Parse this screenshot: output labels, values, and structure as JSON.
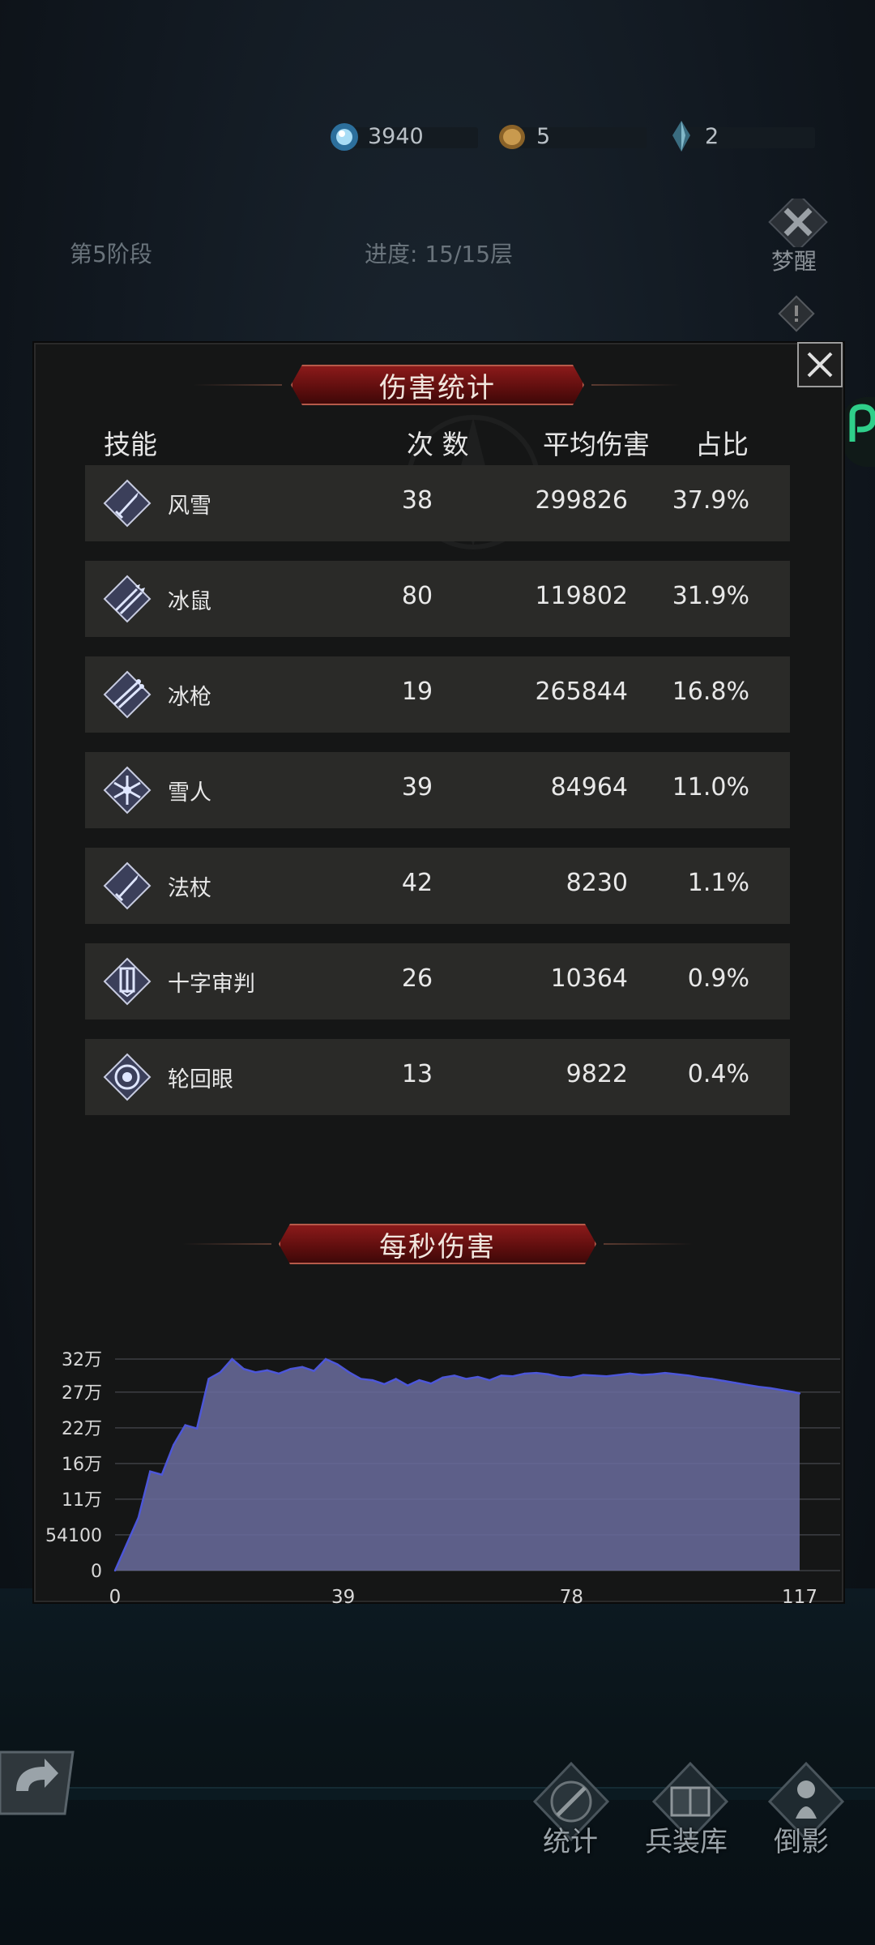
{
  "resources": [
    {
      "icon": "water-orb-icon",
      "value": "3940"
    },
    {
      "icon": "coin-icon",
      "value": "5"
    },
    {
      "icon": "crystal-icon",
      "value": "2"
    }
  ],
  "stage": {
    "label": "第5阶段",
    "progress": "进度: 15/15层"
  },
  "awaken_label": "梦醒",
  "damage_stats": {
    "title": "伤害统计",
    "headers": {
      "skill": "技能",
      "count": "次 数",
      "avg": "平均伤害",
      "ratio": "占比"
    },
    "rows": [
      {
        "icon": "sword-icon",
        "name": "风雪",
        "count": "38",
        "avg": "299826",
        "ratio": "37.9%"
      },
      {
        "icon": "arrows-icon",
        "name": "冰鼠",
        "count": "80",
        "avg": "119802",
        "ratio": "31.9%"
      },
      {
        "icon": "spears-icon",
        "name": "冰枪",
        "count": "19",
        "avg": "265844",
        "ratio": "16.8%"
      },
      {
        "icon": "snowflake-icon",
        "name": "雪人",
        "count": "39",
        "avg": "84964",
        "ratio": "11.0%"
      },
      {
        "icon": "staff-icon",
        "name": "法杖",
        "count": "42",
        "avg": "8230",
        "ratio": "1.1%"
      },
      {
        "icon": "banner-icon",
        "name": "十字审判",
        "count": "26",
        "avg": "10364",
        "ratio": "0.9%"
      },
      {
        "icon": "eye-icon",
        "name": "轮回眼",
        "count": "13",
        "avg": "9822",
        "ratio": "0.4%"
      }
    ]
  },
  "dps": {
    "title": "每秒伤害",
    "accent_color": "#6a6c9e"
  },
  "chart_data": {
    "type": "area",
    "title": "每秒伤害",
    "xlabel": "",
    "ylabel": "",
    "xlim": [
      0,
      117
    ],
    "ylim": [
      0,
      320000
    ],
    "x_ticks": [
      "0",
      "39",
      "78",
      "117"
    ],
    "y_ticks": [
      "0",
      "54100",
      "11万",
      "16万",
      "22万",
      "27万",
      "32万"
    ],
    "x": [
      0,
      2,
      4,
      6,
      8,
      10,
      12,
      14,
      16,
      18,
      20,
      22,
      24,
      26,
      28,
      30,
      32,
      34,
      36,
      38,
      40,
      42,
      44,
      46,
      48,
      50,
      52,
      54,
      56,
      58,
      60,
      62,
      64,
      66,
      68,
      70,
      72,
      74,
      76,
      78,
      80,
      82,
      84,
      86,
      88,
      90,
      92,
      94,
      96,
      98,
      100,
      102,
      104,
      106,
      108,
      110,
      112,
      114,
      116,
      117
    ],
    "values": [
      0,
      40000,
      80000,
      150000,
      145000,
      190000,
      220000,
      215000,
      290000,
      300000,
      320000,
      305000,
      300000,
      303000,
      298000,
      305000,
      308000,
      302000,
      320000,
      312000,
      300000,
      290000,
      288000,
      282000,
      290000,
      280000,
      288000,
      283000,
      292000,
      295000,
      290000,
      293000,
      288000,
      295000,
      294000,
      298000,
      299000,
      297000,
      293000,
      292000,
      296000,
      295000,
      294000,
      296000,
      298000,
      296000,
      297000,
      299000,
      297000,
      295000,
      292000,
      290000,
      287000,
      284000,
      281000,
      278000,
      276000,
      273000,
      270000,
      268000
    ]
  },
  "bottom_nav": [
    {
      "icon": "shield-sword-icon",
      "label": "统计"
    },
    {
      "icon": "book-icon",
      "label": "兵装库"
    },
    {
      "icon": "pawn-icon",
      "label": "倒影"
    }
  ]
}
